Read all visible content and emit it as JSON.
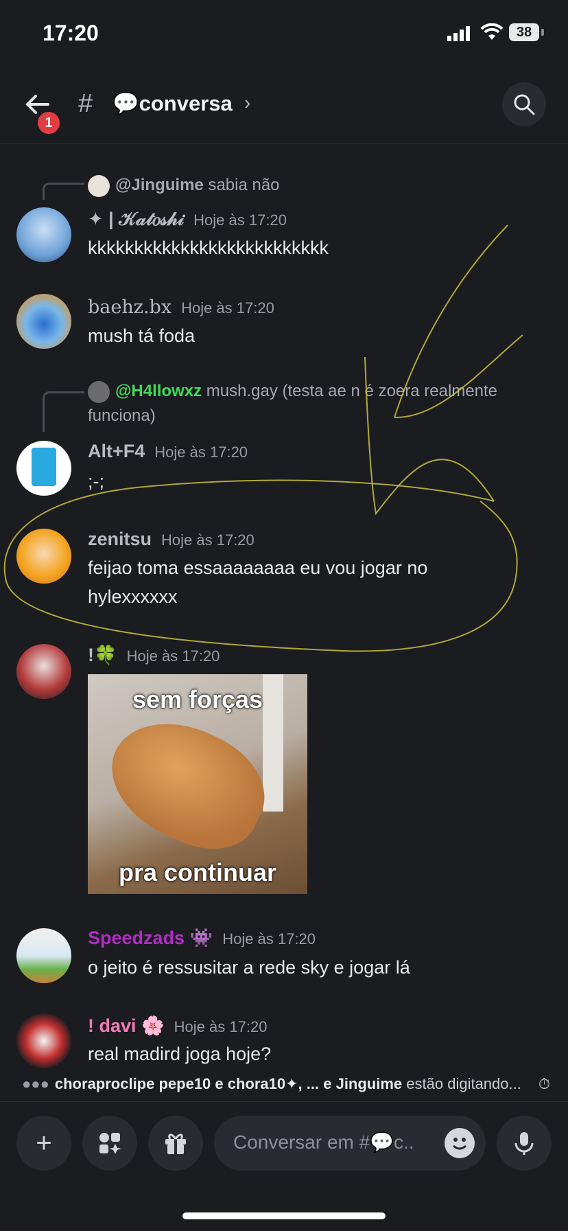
{
  "status": {
    "time": "17:20",
    "battery": "38"
  },
  "header": {
    "badge": "1",
    "hash": "#",
    "channel": "💬conversa",
    "chevron": "›"
  },
  "messages": [
    {
      "reply_to": "@Jinguime",
      "reply_text": "sabia não",
      "user": "✦ | 𝒦𝒶𝓉𝑜𝓈𝒽𝒾",
      "time": "Hoje às 17:20",
      "text": "kkkkkkkkkkkkkkkkkkkkkkkkkk",
      "color": "#b9bbc2"
    },
    {
      "user": "baehz.bx",
      "time": "Hoje às 17:20",
      "text": "mush tá foda",
      "color": "#b9bbc2"
    },
    {
      "reply_to": "@H4llowxz",
      "reply_text": "mush.gay (testa ae n é zoera realmente funciona)",
      "user": "Alt+F4",
      "time": "Hoje às 17:20",
      "text": ";-;",
      "color": "#b9bbc2",
      "reply_color": "#3ddc5a"
    },
    {
      "user": "zenitsu",
      "time": "Hoje às 17:20",
      "text": "feijao toma essaaaaaaaa eu vou jogar no hylexxxxxx",
      "color": "#b9bbc2"
    },
    {
      "user": "!🍀",
      "time": "Hoje às 17:20",
      "meme_top": "sem forças",
      "meme_bottom": "pra continuar",
      "color": "#b9bbc2"
    },
    {
      "user": "Speedzads",
      "badge": "👾",
      "time": "Hoje às 17:20",
      "text": "o jeito é ressusitar a rede sky e jogar lá",
      "color": "#b22cc4"
    },
    {
      "user": "! davi",
      "badge": "🌸",
      "time": "Hoje às 17:20",
      "text": "real madird joga hoje?",
      "color": "#f07cb3"
    }
  ],
  "typing": {
    "names": "choraproclipe pepe10 e chora10✦, ... e Jinguime",
    "suffix": "estão digitando..."
  },
  "composer": {
    "placeholder": "Conversar em #💬c..",
    "plus": "+"
  }
}
